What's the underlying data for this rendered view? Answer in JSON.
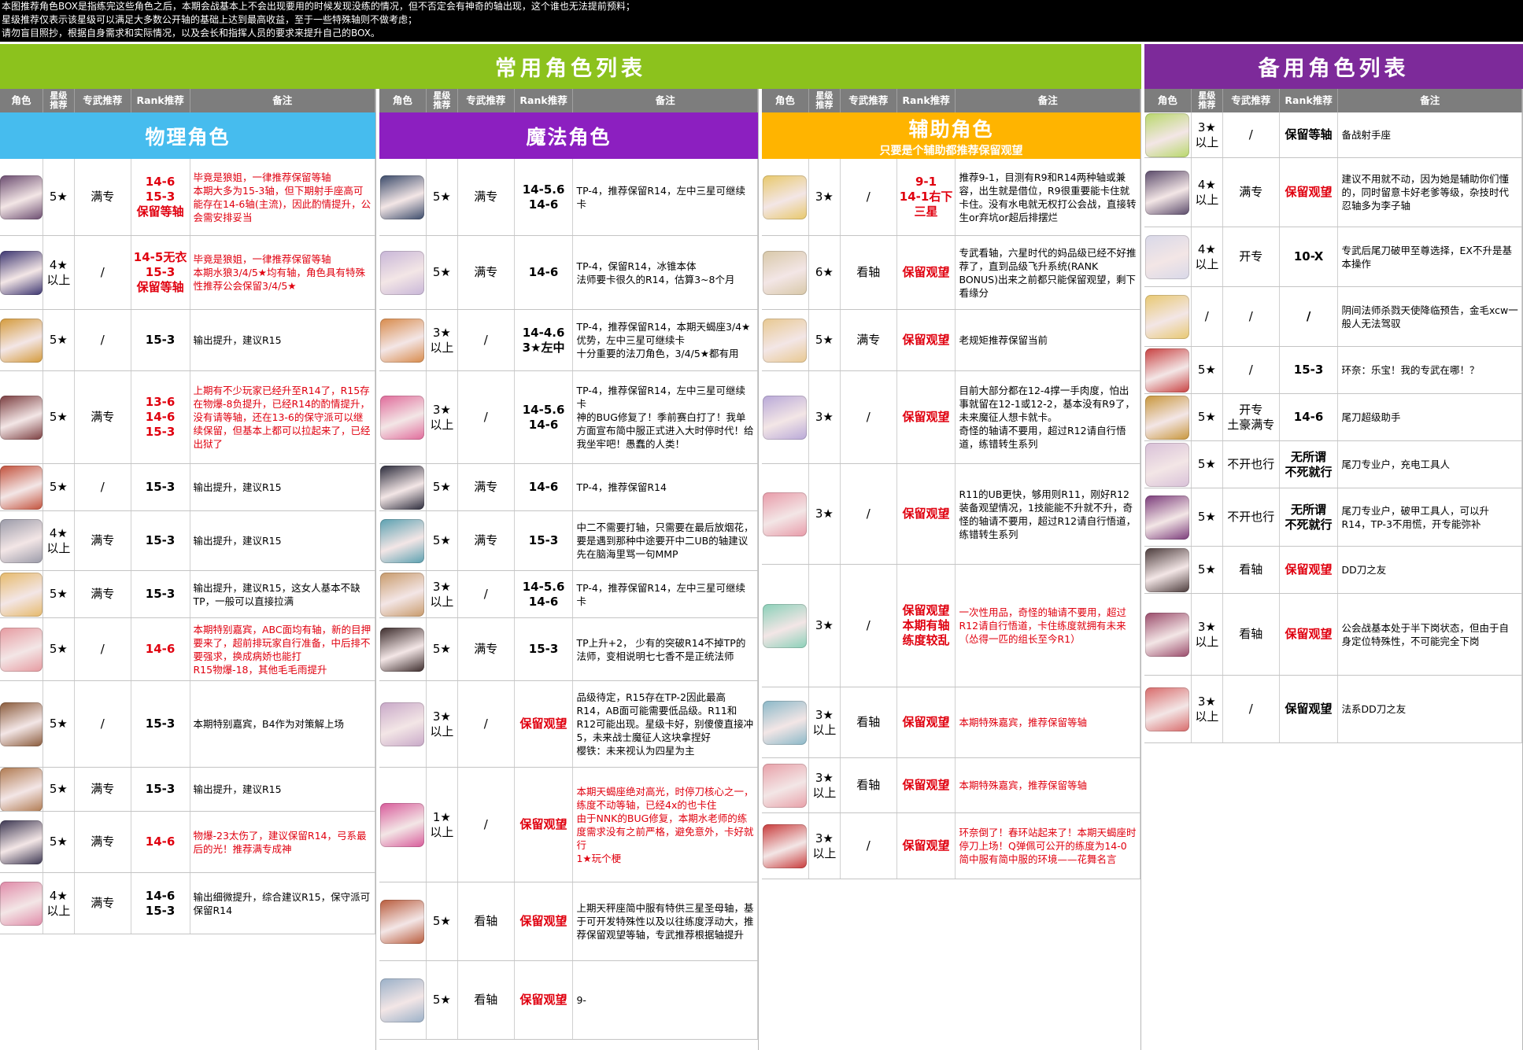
{
  "top_note": [
    "本图推荐角色BOX是指练完这些角色之后，本期会战基本上不会出现要用的时候发现没练的情况，但不否定会有神奇的轴出现，这个谁也无法提前预料；",
    "星级推荐仅表示该星级可以满足大多数公开轴的基础上达到最高收益，至于一些特殊轴则不做考虑；",
    "请勿盲目照抄，根据自身需求和实际情况，以及会长和指挥人员的要求来提升自己的BOX。"
  ],
  "banners": {
    "common": "常用角色列表",
    "backup": "备用角色列表"
  },
  "headers": {
    "char": "角色",
    "star": "星级\n推荐",
    "weapon": "专武推荐",
    "rank": "Rank推荐",
    "note": "备注"
  },
  "colors": {
    "green": "#8cc21d",
    "purple_banner": "#7d2a9a",
    "physical": "#46bcee",
    "magic": "#8c1fc0",
    "support": "#ffb400",
    "red_text": "#e0000f"
  },
  "sections": [
    {
      "title": "物理角色",
      "subtitle": "",
      "rows": [
        {
          "avatar": "#6a4b6f",
          "star": "5★",
          "weapon": "满专",
          "rank": "14-6\n15-3\n保留等轴",
          "rank_red": true,
          "note": "毕竟是狼姐，一律推荐保留等轴\n本期大多为15-3轴，但下期射手座高可能存在14-6轴(主流)，因此酌情提升，公会需安排妥当",
          "note_red": true
        },
        {
          "avatar": "#3b3470",
          "star": "4★\n以上",
          "weapon": "/",
          "rank": "14-5无衣\n15-3\n保留等轴",
          "rank_red": true,
          "note": "毕竟是狼姐，一律推荐保留等轴\n本期水狼3/4/5★均有轴，角色具有特殊性推荐公会保留3/4/5★",
          "note_red": true
        },
        {
          "avatar": "#d49a3a",
          "star": "5★",
          "weapon": "/",
          "rank": "15-3",
          "rank_red": false,
          "note": "输出提升，建议R15",
          "note_red": false
        },
        {
          "avatar": "#7a3c3e",
          "star": "5★",
          "weapon": "满专",
          "rank": "13-6\n14-6\n15-3",
          "rank_red": true,
          "note": "上期有不少玩家已经升至R14了，R15存在物爆-8负提升，已经R14的酌情提升，没有请等轴，还在13-6的保守派可以继续保留，但基本上都可以拉起来了，已经出狱了",
          "note_red": true
        },
        {
          "avatar": "#c2503a",
          "star": "5★",
          "weapon": "/",
          "rank": "15-3",
          "rank_red": false,
          "note": "输出提升，建议R15",
          "note_red": false
        },
        {
          "avatar": "#9a9aa8",
          "star": "4★\n以上",
          "weapon": "满专",
          "rank": "15-3",
          "rank_red": false,
          "note": "输出提升，建议R15",
          "note_red": false
        },
        {
          "avatar": "#e6b96a",
          "star": "5★",
          "weapon": "满专",
          "rank": "15-3",
          "rank_red": false,
          "note": "输出提升，建议R15，这女人基本不缺TP，一般可以直接拉满",
          "note_red": false
        },
        {
          "avatar": "#e69aa0",
          "star": "5★",
          "weapon": "/",
          "rank": "14-6",
          "rank_red": true,
          "note": "本期特别嘉宾，ABC面均有轴，新的目押要来了，超前排玩家自行准备，中后排不要强求，换成病娇也能打\nR15物爆-18，其他毛毛雨提升",
          "note_red": true
        },
        {
          "avatar": "#8a5a3a",
          "star": "5★",
          "weapon": "/",
          "rank": "15-3",
          "rank_red": false,
          "note": "本期特别嘉宾，B4作为对策解上场",
          "note_red": false
        },
        {
          "avatar": "#b07a50",
          "star": "5★",
          "weapon": "满专",
          "rank": "15-3",
          "rank_red": false,
          "note": "输出提升，建议R15",
          "note_red": false
        },
        {
          "avatar": "#3a3550",
          "star": "5★",
          "weapon": "满专",
          "rank": "14-6",
          "rank_red": true,
          "note": "物爆-23太伤了，建议保留R14，弓系最后的光！推荐满专成神",
          "note_red": true
        },
        {
          "avatar": "#e08aa8",
          "star": "4★\n以上",
          "weapon": "满专",
          "rank": "14-6\n15-3",
          "rank_red": false,
          "note": "输出细微提升，综合建议R15，保守派可保留R14",
          "note_red": false
        }
      ]
    },
    {
      "title": "魔法角色",
      "subtitle": "",
      "rows": [
        {
          "avatar": "#3a4a6a",
          "star": "5★",
          "weapon": "满专",
          "rank": "14-5.6\n14-6",
          "rank_red": false,
          "note": "TP-4，推荐保留R14，左中三星可继续卡",
          "note_red": false
        },
        {
          "avatar": "#c8b6d8",
          "star": "5★",
          "weapon": "满专",
          "rank": "14-6",
          "rank_red": false,
          "note": "TP-4，保留R14，冰锥本体\n法师要卡很久的R14，估算3~8个月",
          "note_red": false
        },
        {
          "avatar": "#d88a4a",
          "star": "3★\n以上",
          "weapon": "/",
          "rank": "14-4.6\n3★左中",
          "rank_red": false,
          "note": "TP-4，推荐保留R14，本期天蝎座3/4★优势，左中三星可继续卡\n十分重要的法刀角色，3/4/5★都有用",
          "note_red": false
        },
        {
          "avatar": "#e06a9a",
          "star": "3★\n以上",
          "weapon": "/",
          "rank": "14-5.6\n14-6",
          "rank_red": false,
          "note": "TP-4，推荐保留R14，左中三星可继续卡\n神的BUG修复了！季前赛白打了！我单方面宣布简中服正式进入大时停时代！给我坐牢吧！愚蠢的人类！",
          "note_red": false
        },
        {
          "avatar": "#2a2a3a",
          "star": "5★",
          "weapon": "满专",
          "rank": "14-6",
          "rank_red": false,
          "note": "TP-4，推荐保留R14",
          "note_red": false
        },
        {
          "avatar": "#5aa0b0",
          "star": "5★",
          "weapon": "满专",
          "rank": "15-3",
          "rank_red": false,
          "note": "中二不需要打轴，只需要在最后放烟花，要是遇到那种中途要开中二UB的轴建议先在脑海里骂一句MMP",
          "note_red": false
        },
        {
          "avatar": "#c89a6a",
          "star": "3★\n以上",
          "weapon": "/",
          "rank": "14-5.6\n14-6",
          "rank_red": false,
          "note": "TP-4，推荐保留R14，左中三星可继续卡",
          "note_red": false
        },
        {
          "avatar": "#3a2a2a",
          "star": "5★",
          "weapon": "满专",
          "rank": "15-3",
          "rank_red": false,
          "note": "TP上升+2， 少有的突破R14不掉TP的法师，变相说明七七香不是正统法师",
          "note_red": false
        },
        {
          "avatar": "#c8a8c8",
          "star": "3★\n以上",
          "weapon": "/",
          "rank": "保留观望",
          "rank_red": true,
          "note": "品级待定，R15存在TP-2因此最高R14，AB面可能需要低品级。R11和R12可能出现。星级卡好，别傻傻直接冲5，未来战士魔征人这块拿捏好\n樱铁：未来视认为四星为主",
          "note_red": false
        },
        {
          "avatar": "#d85a9a",
          "star": "1★\n以上",
          "weapon": "/",
          "rank": "保留观望",
          "rank_red": true,
          "note": "本期天蝎座绝对高光，时停刀核心之一，练度不动等轴，已经4x的也卡住\n由于NNK的BUG修复，本期水老师的练度需求没有之前严格，避免意外，卡好就行\n1★玩个梗",
          "note_red": true
        },
        {
          "avatar": "#b85a3a",
          "star": "5★",
          "weapon": "看轴",
          "rank": "保留观望",
          "rank_red": true,
          "note": "上期天秤座简中服有特供三星圣母轴，基于可开发特殊性以及以往练度浮动大，推荐保留观望等轴，专武推荐根据轴提升",
          "note_red": false
        },
        {
          "avatar": "#9ab0c8",
          "star": "5★",
          "weapon": "看轴",
          "rank": "保留观望",
          "rank_red": true,
          "note": "9-",
          "note_red": false
        }
      ]
    },
    {
      "title": "辅助角色",
      "subtitle": "只要是个辅助都推荐保留观望",
      "rows": [
        {
          "avatar": "#e8c86a",
          "star": "3★",
          "weapon": "/",
          "rank": "9-1\n14-1右下\n三星",
          "rank_red": true,
          "note": "推荐9-1，目测有R9和R14两种轴或兼容，出生就是借位，R9很重要能卡住就卡住。没有水电就无权打公会战，直接转生or弃坑or超后排摆烂",
          "note_red": false
        },
        {
          "avatar": "#d8c8a8",
          "star": "6★",
          "weapon": "看轴",
          "rank": "保留观望",
          "rank_red": true,
          "note": "专武看轴，六星时代的妈品级已经不好推荐了，直到品级飞升系统(RANK BONUS)出来之前都只能保留观望，剩下看缘分",
          "note_red": false
        },
        {
          "avatar": "#e8c890",
          "star": "5★",
          "weapon": "满专",
          "rank": "保留观望",
          "rank_red": true,
          "note": "老规矩推荐保留当前",
          "note_red": false
        },
        {
          "avatar": "#b8a8d8",
          "star": "3★",
          "weapon": "/",
          "rank": "保留观望",
          "rank_red": true,
          "note": "目前大部分都在12-4撑一手肉度，怕出事就留在12-1或12-2，基本没有R9了，未来魔征人想卡就卡。\n奇怪的轴请不要用，超过R12请自行悟道，练错转生系列",
          "note_red": false
        },
        {
          "avatar": "#e89aa8",
          "star": "3★",
          "weapon": "/",
          "rank": "保留观望",
          "rank_red": true,
          "note": "R11的UB更快，够用则R11，刚好R12装备观望情况，1技能能不升就不升，奇怪的轴请不要用，超过R12请自行悟道，练错转生系列",
          "note_red": false
        },
        {
          "avatar": "#8ad0b8",
          "star": "3★",
          "weapon": "/",
          "rank": "保留观望\n本期有轴\n练度较乱",
          "rank_red": true,
          "note": "一次性用品，奇怪的轴请不要用，超过R12请自行悟道，卡住练度就拥有未来\n（怂得一匹的组长至今R1）",
          "note_red": true
        },
        {
          "avatar": "#8ab8c8",
          "star": "3★\n以上",
          "weapon": "看轴",
          "rank": "保留观望",
          "rank_red": true,
          "note": "本期特殊嘉宾，推荐保留等轴",
          "note_red": true
        },
        {
          "avatar": "#e8a0a8",
          "star": "3★\n以上",
          "weapon": "看轴",
          "rank": "保留观望",
          "rank_red": true,
          "note": "本期特殊嘉宾，推荐保留等轴",
          "note_red": true
        },
        {
          "avatar": "#c83a3a",
          "star": "3★\n以上",
          "weapon": "/",
          "rank": "保留观望",
          "rank_red": true,
          "note": "环奈倒了！春环站起来了！本期天蝎座时停刀上场！Q弹佩可公开的练度为14-0\n简中服有简中服的环境——花舞名言",
          "note_red": true
        }
      ]
    },
    {
      "title": "",
      "subtitle": "",
      "rows": [
        {
          "avatar": "#b8d86a",
          "star": "3★\n以上",
          "weapon": "/",
          "rank": "保留等轴",
          "rank_red": false,
          "note": "备战射手座",
          "note_red": false
        },
        {
          "avatar": "#5a4a6a",
          "star": "4★\n以上",
          "weapon": "满专",
          "rank": "保留观望",
          "rank_red": true,
          "note": "建议不用就不动，因为她是辅助你们懂的，同时留意卡好老爹等级，杂技时代忍轴多为李子轴",
          "note_red": false
        },
        {
          "avatar": "#d8d8e8",
          "star": "4★\n以上",
          "weapon": "开专",
          "rank": "10-X",
          "rank_red": false,
          "note": "专武后尾刀破甲至尊选择，EX不升是基本操作",
          "note_red": false
        },
        {
          "avatar": "#e8c870",
          "star": "/",
          "weapon": "/",
          "rank": "/",
          "rank_red": false,
          "note": "阴间法师杀戮天使降临预告，金毛xcw一般人无法驾驭",
          "note_red": false
        },
        {
          "avatar": "#c84040",
          "star": "5★",
          "weapon": "/",
          "rank": "15-3",
          "rank_red": false,
          "note": "环奈：乐宝！我的专武在哪！？",
          "note_red": false
        },
        {
          "avatar": "#c8963a",
          "star": "5★",
          "weapon": "开专\n土豪满专",
          "rank": "14-6",
          "rank_red": false,
          "note": "尾刀超级助手",
          "note_red": false
        },
        {
          "avatar": "#d8c0d8",
          "star": "5★",
          "weapon": "不开也行",
          "rank": "无所谓\n不死就行",
          "rank_red": false,
          "note": "尾刀专业户，充电工具人",
          "note_red": false
        },
        {
          "avatar": "#7a3a7a",
          "star": "5★",
          "weapon": "不开也行",
          "rank": "无所谓\n不死就行",
          "rank_red": false,
          "note": "尾刀专业户，破甲工具人，可以升R14，TP-3不用慌，开专能弥补",
          "note_red": false
        },
        {
          "avatar": "#4a3a3a",
          "star": "5★",
          "weapon": "看轴",
          "rank": "保留观望",
          "rank_red": true,
          "note": "DD刀之友",
          "note_red": false
        },
        {
          "avatar": "#9a4a6a",
          "star": "3★\n以上",
          "weapon": "看轴",
          "rank": "保留观望",
          "rank_red": true,
          "note": "公会战基本处于半下岗状态，但由于自身定位特殊性，不可能完全下岗",
          "note_red": false
        },
        {
          "avatar": "#d86a6a",
          "star": "3★\n以上",
          "weapon": "/",
          "rank": "保留观望",
          "rank_red": false,
          "note": "法系DD刀之友",
          "note_red": false
        }
      ]
    }
  ]
}
